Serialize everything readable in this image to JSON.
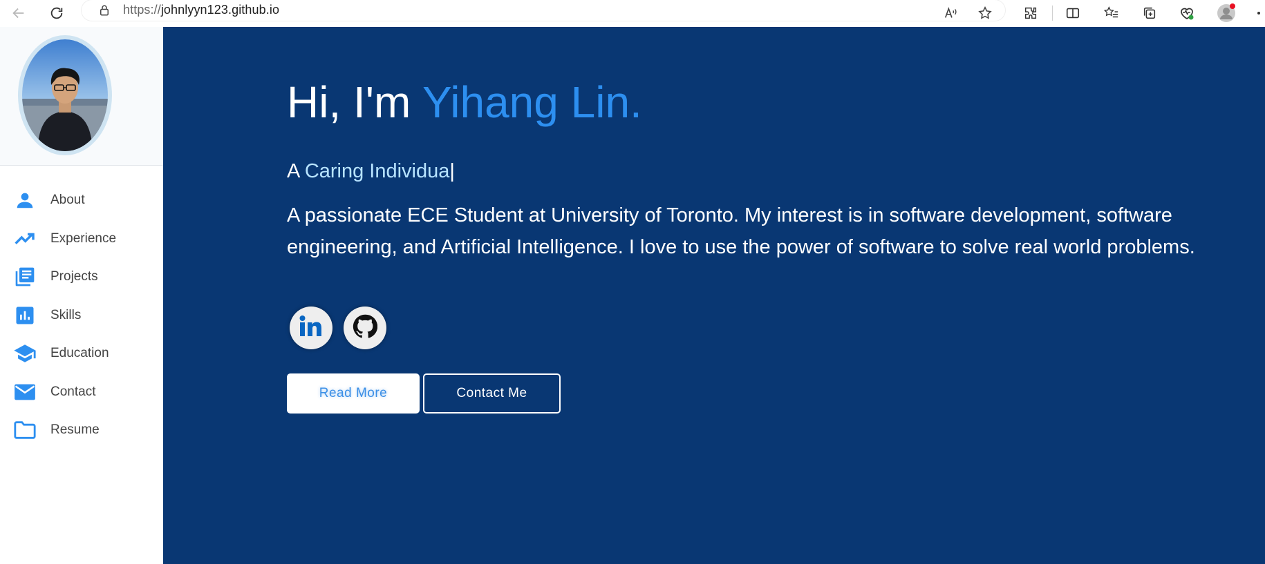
{
  "browser": {
    "url_protocol": "https://",
    "url_host": "johnlyyn123.github.io"
  },
  "sidebar": {
    "items": [
      {
        "label": "About",
        "icon": "person-icon"
      },
      {
        "label": "Experience",
        "icon": "trending-up-icon"
      },
      {
        "label": "Projects",
        "icon": "library-books-icon"
      },
      {
        "label": "Skills",
        "icon": "bar-chart-icon"
      },
      {
        "label": "Education",
        "icon": "school-icon"
      },
      {
        "label": "Contact",
        "icon": "mail-icon"
      },
      {
        "label": "Resume",
        "icon": "folder-icon"
      }
    ]
  },
  "hero": {
    "greeting": "Hi, I'm ",
    "name": "Yihang Lin.",
    "typed_prefix": "A ",
    "typed_trait": "Caring Individua",
    "typed_cursor": "|",
    "bio": "A passionate ECE Student at University of Toronto. My interest is in software development, software engineering, and Artificial Intelligence. I love to use the power of software to solve real world problems.",
    "read_more_label": "Read More",
    "contact_label": "Contact Me"
  },
  "colors": {
    "main_background": "#093773",
    "accent": "#2d8ff0",
    "sidebar_icon": "#2d8ff0"
  }
}
